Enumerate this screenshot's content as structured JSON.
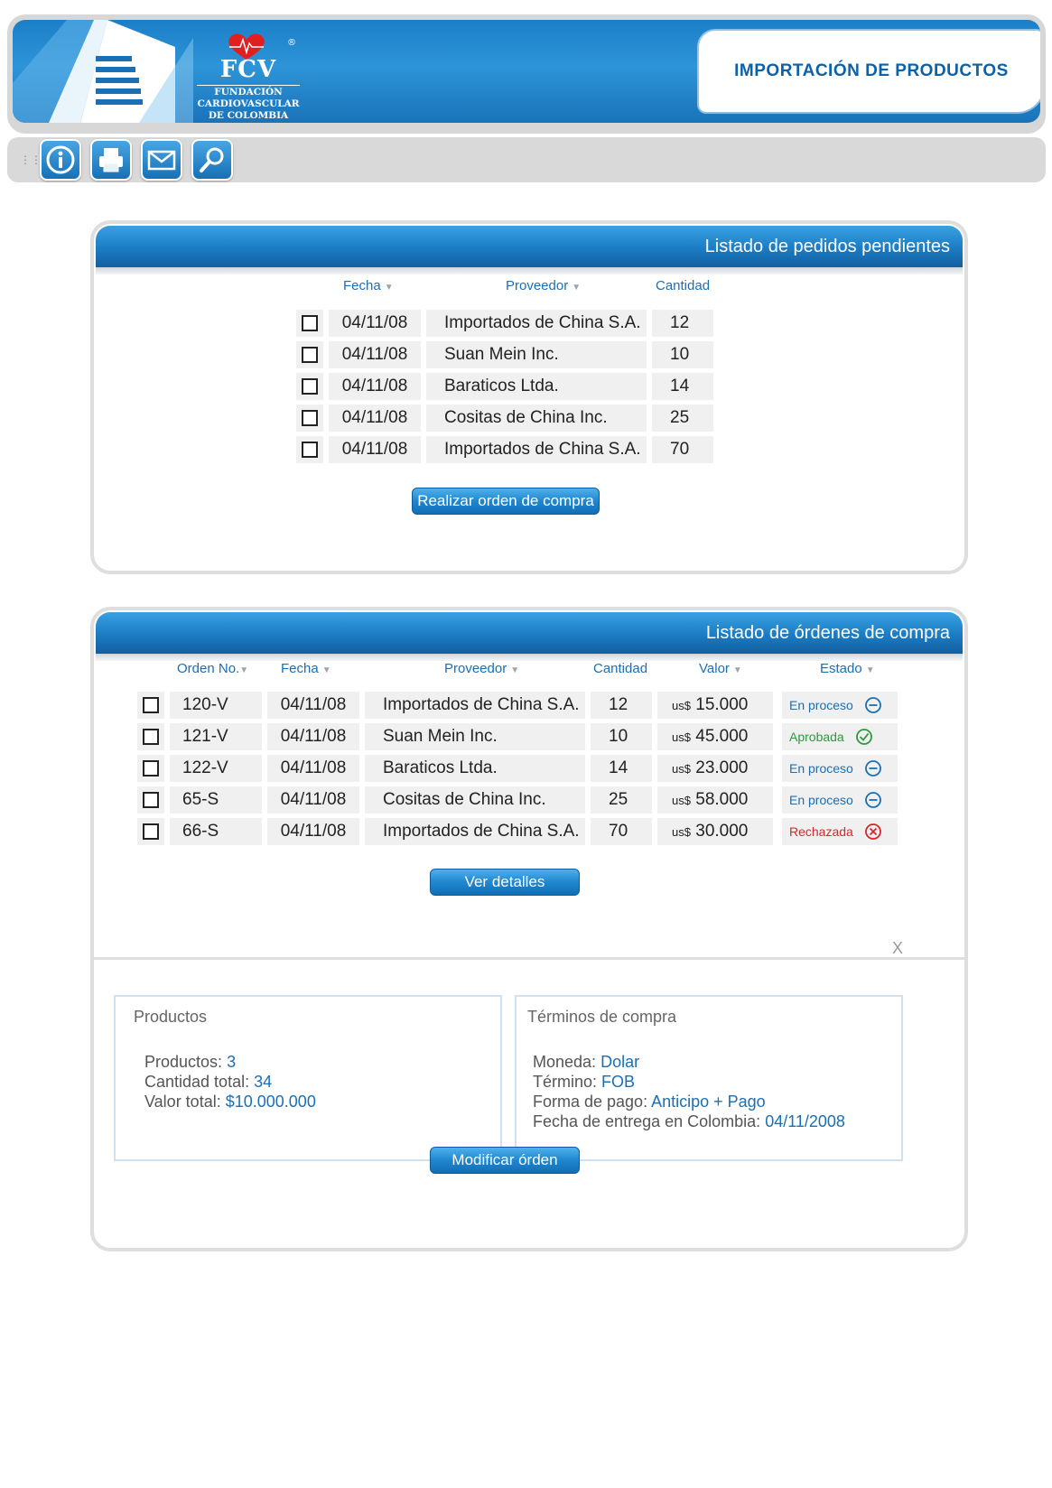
{
  "header": {
    "title": "IMPORTACIÓN DE PRODUCTOS",
    "logo": {
      "mark": "FCV",
      "line1": "FUNDACIÓN",
      "line2": "CARDIOVASCULAR",
      "line3": "DE COLOMBIA",
      "reg": "®"
    }
  },
  "toolbar": {
    "icons": [
      "info-icon",
      "print-icon",
      "mail-icon",
      "search-icon"
    ]
  },
  "pending": {
    "title": "Listado de pedidos pendientes",
    "columns": {
      "fecha": "Fecha",
      "proveedor": "Proveedor",
      "cantidad": "Cantidad"
    },
    "rows": [
      {
        "fecha": "04/11/08",
        "proveedor": "Importados de China S.A.",
        "cantidad": "12"
      },
      {
        "fecha": "04/11/08",
        "proveedor": "Suan Mein Inc.",
        "cantidad": "10"
      },
      {
        "fecha": "04/11/08",
        "proveedor": "Baraticos Ltda.",
        "cantidad": "14"
      },
      {
        "fecha": "04/11/08",
        "proveedor": "Cositas de China Inc.",
        "cantidad": "25"
      },
      {
        "fecha": "04/11/08",
        "proveedor": "Importados de China S.A.",
        "cantidad": "70"
      }
    ],
    "button": "Realizar orden de compra"
  },
  "orders": {
    "title": "Listado de órdenes de compra",
    "columns": {
      "orden": "Orden No.",
      "fecha": "Fecha",
      "proveedor": "Proveedor",
      "cantidad": "Cantidad",
      "valor": "Valor",
      "estado": "Estado"
    },
    "currency": "us$",
    "rows": [
      {
        "orden": "120-V",
        "fecha": "04/11/08",
        "proveedor": "Importados de China S.A.",
        "cantidad": "12",
        "valor": "15.000",
        "estado": "En proceso",
        "tipo": "proceso"
      },
      {
        "orden": "121-V",
        "fecha": "04/11/08",
        "proveedor": "Suan Mein Inc.",
        "cantidad": "10",
        "valor": "45.000",
        "estado": "Aprobada",
        "tipo": "aprobada"
      },
      {
        "orden": "122-V",
        "fecha": "04/11/08",
        "proveedor": "Baraticos Ltda.",
        "cantidad": "14",
        "valor": "23.000",
        "estado": "En proceso",
        "tipo": "proceso"
      },
      {
        "orden": "65-S",
        "fecha": "04/11/08",
        "proveedor": "Cositas de China Inc.",
        "cantidad": "25",
        "valor": "58.000",
        "estado": "En proceso",
        "tipo": "proceso"
      },
      {
        "orden": "66-S",
        "fecha": "04/11/08",
        "proveedor": "Importados de China S.A.",
        "cantidad": "70",
        "valor": "30.000",
        "estado": "Rechazada",
        "tipo": "rechazada"
      }
    ],
    "status_colors": {
      "proceso": "#1a6fb5",
      "aprobada": "#2e9a3a",
      "rechazada": "#d9262b"
    },
    "button": "Ver detalles"
  },
  "details": {
    "close": "X",
    "productos": {
      "title": "Productos",
      "lines": [
        {
          "label": "Productos:",
          "value": "3"
        },
        {
          "label": "Cantidad total:",
          "value": "34"
        },
        {
          "label": "Valor total:",
          "value": "$10.000.000"
        }
      ]
    },
    "terminos": {
      "title": "Términos de compra",
      "lines": [
        {
          "label": "Moneda:",
          "value": "Dolar"
        },
        {
          "label": "Término:",
          "value": "FOB"
        },
        {
          "label": "Forma de pago:",
          "value": "Anticipo + Pago"
        },
        {
          "label": "Fecha de entrega en Colombia:",
          "value": "04/11/2008"
        }
      ]
    },
    "button": "Modificar órden"
  }
}
